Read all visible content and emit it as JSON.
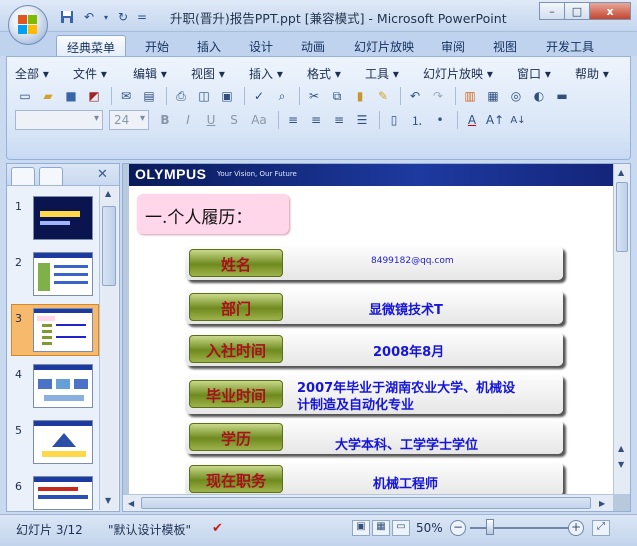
{
  "window": {
    "title": "升职(晋升)报告PPT.ppt [兼容模式] - Microsoft PowerPoint",
    "minimize": "–",
    "maximize": "□",
    "close": "x"
  },
  "quick_access": {
    "save_icon": "save-icon",
    "undo_icon": "undo-icon",
    "redo_icon": "redo-icon",
    "customize": "="
  },
  "ribbon_tabs": [
    "经典菜单",
    "开始",
    "插入",
    "设计",
    "动画",
    "幻灯片放映",
    "审阅",
    "视图",
    "开发工具"
  ],
  "active_tab": 0,
  "classic_menu": [
    "全部 ▾",
    "文件 ▾",
    "编辑 ▾",
    "视图 ▾",
    "插入 ▾",
    "格式 ▾",
    "工具 ▾",
    "幻灯片放映 ▾",
    "窗口 ▾",
    "帮助 ▾"
  ],
  "font": {
    "name_value": "",
    "size_value": "24"
  },
  "slide_panel": {
    "thumbnails": [
      "1",
      "2",
      "3",
      "4",
      "5",
      "6"
    ],
    "selected": 3
  },
  "slide": {
    "brand": "OLYMPUS",
    "tagline": "Your Vision, Our Future",
    "heading": "一.个人履历：",
    "rows": [
      {
        "label": "姓名",
        "value": "8499182@qq.com"
      },
      {
        "label": "部门",
        "value": "显微镜技术T"
      },
      {
        "label": "入社时间",
        "value": "2008年8月"
      },
      {
        "label": "毕业时间",
        "value_line1": "2007年毕业于湖南农业大学、机械设",
        "value_line2": "计制造及自动化专业"
      },
      {
        "label": "学历",
        "value": "大学本科、工学学士学位"
      },
      {
        "label": "现在职务",
        "value": "机械工程师"
      }
    ]
  },
  "status_bar": {
    "slide_info": "幻灯片 3/12",
    "theme": "\"默认设计模板\"",
    "zoom": "50%",
    "zoom_out": "−",
    "zoom_in": "+"
  },
  "colors": {
    "accent": "#1d3aa0",
    "label_text": "#a8101a",
    "value_text": "#1515d8",
    "heading_bg": "#ffd6ea",
    "selected_thumb": "#f7b96b"
  }
}
